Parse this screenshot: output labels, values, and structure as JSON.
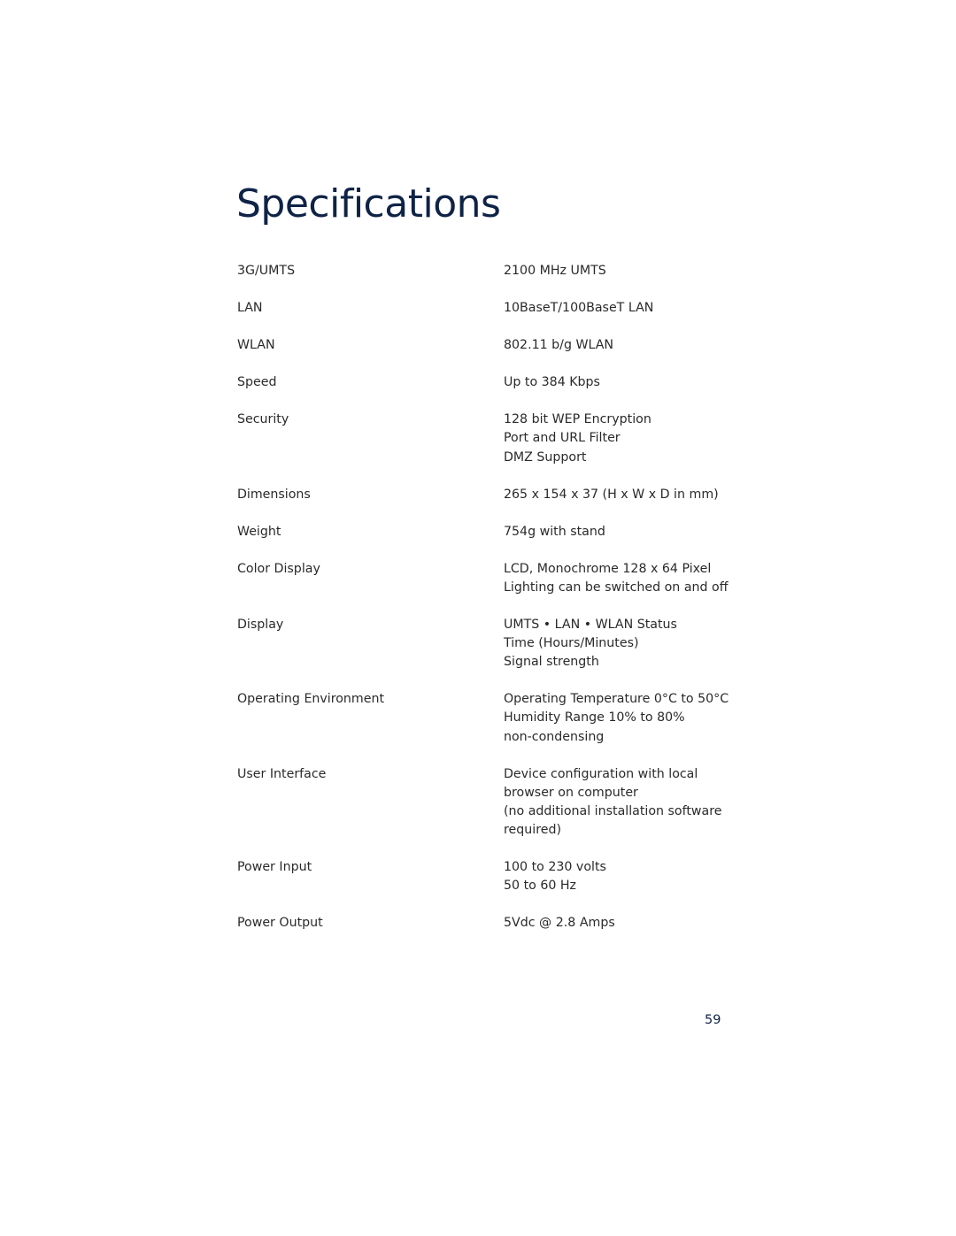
{
  "page": {
    "title": "Specifications",
    "page_number": "59"
  },
  "specs": [
    {
      "label": "3G/UMTS",
      "value": [
        "2100 MHz UMTS"
      ]
    },
    {
      "label": "LAN",
      "value": [
        "10BaseT/100BaseT LAN"
      ]
    },
    {
      "label": "WLAN",
      "value": [
        "802.11 b/g WLAN"
      ]
    },
    {
      "label": "Speed",
      "value": [
        "Up to 384 Kbps"
      ]
    },
    {
      "label": "Security",
      "value": [
        "128 bit WEP Encryption",
        "Port and URL Filter",
        "DMZ Support"
      ]
    },
    {
      "label": "Dimensions",
      "value": [
        "265 x 154 x 37 (H x W x D in mm)"
      ]
    },
    {
      "label": "Weight",
      "value": [
        "754g with stand"
      ]
    },
    {
      "label": "Color Display",
      "value": [
        "LCD, Monochrome 128 x 64 Pixel",
        "Lighting can be switched on and off"
      ]
    },
    {
      "label": "Display",
      "value": [
        "UMTS • LAN • WLAN Status",
        "Time (Hours/Minutes)",
        "Signal strength"
      ]
    },
    {
      "label": "Operating Environment",
      "value": [
        "Operating Temperature 0°C to 50°C",
        "Humidity Range 10% to 80%",
        "non-condensing"
      ]
    },
    {
      "label": "User Interface",
      "value": [
        "Device configuration with local",
        "browser on computer",
        "(no additional installation software",
        "required)"
      ]
    },
    {
      "label": "Power Input",
      "value": [
        "100 to 230 volts",
        "50 to 60 Hz"
      ]
    },
    {
      "label": "Power Output",
      "value": [
        "5Vdc @ 2.8 Amps"
      ]
    }
  ],
  "colors": {
    "title": "#0f2346",
    "body_text": "#2a2a2a"
  }
}
